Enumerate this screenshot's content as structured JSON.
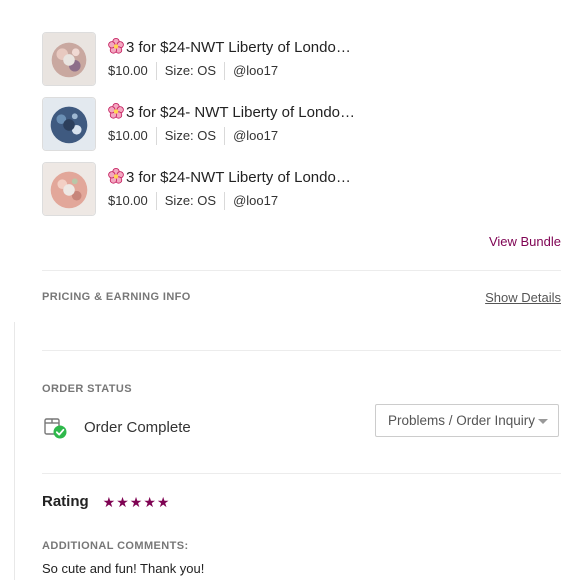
{
  "items": [
    {
      "title": "3 for $24-NWT Liberty of London…",
      "price": "$10.00",
      "size": "Size: OS",
      "seller": "@loo17",
      "thumb_color": "#c9a8a0"
    },
    {
      "title": "3 for $24- NWT Liberty of Londo…",
      "price": "$10.00",
      "size": "Size: OS",
      "seller": "@loo17",
      "thumb_color": "#3f5a80"
    },
    {
      "title": "3 for $24-NWT Liberty of London…",
      "price": "$10.00",
      "size": "Size: OS",
      "seller": "@loo17",
      "thumb_color": "#e2a79a"
    }
  ],
  "view_bundle": "View Bundle",
  "pricing": {
    "label": "PRICING & EARNING INFO",
    "show_details": "Show Details"
  },
  "order_status": {
    "label": "ORDER STATUS",
    "status": "Order Complete",
    "inquiry": "Problems / Order Inquiry"
  },
  "rating": {
    "label": "Rating",
    "stars": 5
  },
  "comments": {
    "label": "ADDITIONAL COMMENTS:",
    "text": "So cute and fun! Thank you!"
  },
  "colors": {
    "accent": "#7f0353",
    "success": "#2eb84b"
  }
}
